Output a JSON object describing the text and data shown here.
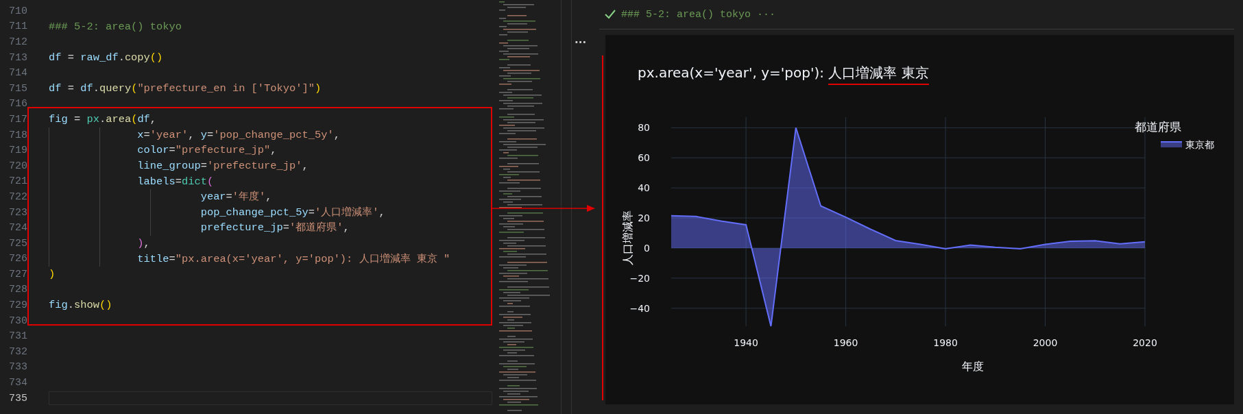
{
  "editor": {
    "lines": [
      {
        "number": "710",
        "current": false
      },
      {
        "number": "711",
        "current": false,
        "tokens": [
          {
            "kind": "comment",
            "text": "### 5-2: area() tokyo"
          }
        ]
      },
      {
        "number": "712",
        "current": false
      },
      {
        "number": "713",
        "current": false,
        "tokens": [
          {
            "kind": "var",
            "text": "df"
          },
          {
            "kind": "plain",
            "text": " = "
          },
          {
            "kind": "var",
            "text": "raw_df"
          },
          {
            "kind": "plain",
            "text": "."
          },
          {
            "kind": "fn",
            "text": "copy"
          },
          {
            "kind": "bracket1",
            "text": "()"
          }
        ]
      },
      {
        "number": "714",
        "current": false
      },
      {
        "number": "715",
        "current": false,
        "tokens": [
          {
            "kind": "var",
            "text": "df"
          },
          {
            "kind": "plain",
            "text": " = "
          },
          {
            "kind": "var",
            "text": "df"
          },
          {
            "kind": "plain",
            "text": "."
          },
          {
            "kind": "fn",
            "text": "query"
          },
          {
            "kind": "bracket1",
            "text": "("
          },
          {
            "kind": "string",
            "text": "\"prefecture_en in ['Tokyo']\""
          },
          {
            "kind": "bracket1",
            "text": ")"
          }
        ]
      },
      {
        "number": "716",
        "current": false
      },
      {
        "number": "717",
        "current": false,
        "tokens": [
          {
            "kind": "var",
            "text": "fig"
          },
          {
            "kind": "plain",
            "text": " = "
          },
          {
            "kind": "class",
            "text": "px"
          },
          {
            "kind": "plain",
            "text": "."
          },
          {
            "kind": "fn",
            "text": "area"
          },
          {
            "kind": "bracket1",
            "text": "("
          },
          {
            "kind": "var",
            "text": "df"
          },
          {
            "kind": "plain",
            "text": ","
          }
        ]
      },
      {
        "number": "718",
        "current": false,
        "tokens": [
          {
            "kind": "var",
            "text": "              x"
          },
          {
            "kind": "plain",
            "text": "="
          },
          {
            "kind": "string",
            "text": "'year'"
          },
          {
            "kind": "plain",
            "text": ", "
          },
          {
            "kind": "var",
            "text": "y"
          },
          {
            "kind": "plain",
            "text": "="
          },
          {
            "kind": "string",
            "text": "'pop_change_pct_5y'"
          },
          {
            "kind": "plain",
            "text": ","
          }
        ]
      },
      {
        "number": "719",
        "current": false,
        "tokens": [
          {
            "kind": "var",
            "text": "              color"
          },
          {
            "kind": "plain",
            "text": "="
          },
          {
            "kind": "string",
            "text": "\"prefecture_jp\""
          },
          {
            "kind": "plain",
            "text": ","
          }
        ]
      },
      {
        "number": "720",
        "current": false,
        "tokens": [
          {
            "kind": "var",
            "text": "              line_group"
          },
          {
            "kind": "plain",
            "text": "="
          },
          {
            "kind": "string",
            "text": "'prefecture_jp'"
          },
          {
            "kind": "plain",
            "text": ","
          }
        ]
      },
      {
        "number": "721",
        "current": false,
        "tokens": [
          {
            "kind": "var",
            "text": "              labels"
          },
          {
            "kind": "plain",
            "text": "="
          },
          {
            "kind": "class",
            "text": "dict"
          },
          {
            "kind": "bracket2",
            "text": "("
          }
        ]
      },
      {
        "number": "722",
        "current": false,
        "tokens": [
          {
            "kind": "var",
            "text": "                        year"
          },
          {
            "kind": "plain",
            "text": "="
          },
          {
            "kind": "string",
            "text": "'年度'"
          },
          {
            "kind": "plain",
            "text": ","
          }
        ]
      },
      {
        "number": "723",
        "current": false,
        "tokens": [
          {
            "kind": "var",
            "text": "                        pop_change_pct_5y"
          },
          {
            "kind": "plain",
            "text": "="
          },
          {
            "kind": "string",
            "text": "'人口増減率'"
          },
          {
            "kind": "plain",
            "text": ","
          }
        ]
      },
      {
        "number": "724",
        "current": false,
        "tokens": [
          {
            "kind": "var",
            "text": "                        prefecture_jp"
          },
          {
            "kind": "plain",
            "text": "="
          },
          {
            "kind": "string",
            "text": "'都道府県'"
          },
          {
            "kind": "plain",
            "text": ","
          }
        ]
      },
      {
        "number": "725",
        "current": false,
        "tokens": [
          {
            "kind": "bracket2",
            "text": "              )"
          },
          {
            "kind": "plain",
            "text": ","
          }
        ]
      },
      {
        "number": "726",
        "current": false,
        "tokens": [
          {
            "kind": "var",
            "text": "              title"
          },
          {
            "kind": "plain",
            "text": "="
          },
          {
            "kind": "string",
            "text": "\"px.area(x='year', y='pop'): 人口増減率 東京 \""
          }
        ]
      },
      {
        "number": "727",
        "current": false,
        "tokens": [
          {
            "kind": "bracket1",
            "text": ")"
          }
        ]
      },
      {
        "number": "728",
        "current": false
      },
      {
        "number": "729",
        "current": false,
        "tokens": [
          {
            "kind": "var",
            "text": "fig"
          },
          {
            "kind": "plain",
            "text": "."
          },
          {
            "kind": "fn",
            "text": "show"
          },
          {
            "kind": "bracket1",
            "text": "()"
          }
        ]
      },
      {
        "number": "730",
        "current": false
      },
      {
        "number": "731",
        "current": false
      },
      {
        "number": "732",
        "current": false
      },
      {
        "number": "733",
        "current": false
      },
      {
        "number": "734",
        "current": false
      },
      {
        "number": "735",
        "current": true
      }
    ]
  },
  "cell": {
    "header": "### 5-2: area() tokyo ···",
    "menu": "···"
  },
  "output": {
    "title_parts": [
      {
        "text": "px.area(x='year', y='pop'): ",
        "underlined": false
      },
      {
        "text": "人口増減率 東京",
        "underlined": true
      }
    ],
    "legend": {
      "title": "都道府県"
    },
    "chart_data": {
      "type": "area",
      "xlabel": "年度",
      "ylabel": "人口増減率",
      "grid": true,
      "x": [
        1925,
        1930,
        1935,
        1940,
        1945,
        1950,
        1955,
        1960,
        1965,
        1970,
        1975,
        1980,
        1985,
        1990,
        1995,
        2000,
        2005,
        2010,
        2015,
        2020
      ],
      "series": [
        {
          "name": "東京都",
          "color": "#636efa",
          "values": [
            21.5,
            21,
            18,
            15.5,
            -52,
            80,
            28,
            20.5,
            12.5,
            5,
            2.5,
            -0.5,
            2,
            0.5,
            -0.5,
            2.5,
            4.5,
            4.8,
            2.8,
            4.2
          ]
        }
      ],
      "xlim": [
        1925,
        2020
      ],
      "ylim": [
        -52,
        87
      ],
      "xticks": [
        1940,
        1960,
        1980,
        2000,
        2020
      ],
      "yticks": [
        {
          "value": 80,
          "label": "80"
        },
        {
          "value": 60,
          "label": "60"
        },
        {
          "value": 40,
          "label": "40"
        },
        {
          "value": 20,
          "label": "20"
        },
        {
          "value": 0,
          "label": "0"
        },
        {
          "value": -20,
          "label": "−20"
        },
        {
          "value": -40,
          "label": "−40"
        }
      ]
    }
  },
  "annotations": [
    {
      "kind": "box"
    },
    {
      "kind": "arrow"
    },
    {
      "kind": "bar"
    }
  ]
}
